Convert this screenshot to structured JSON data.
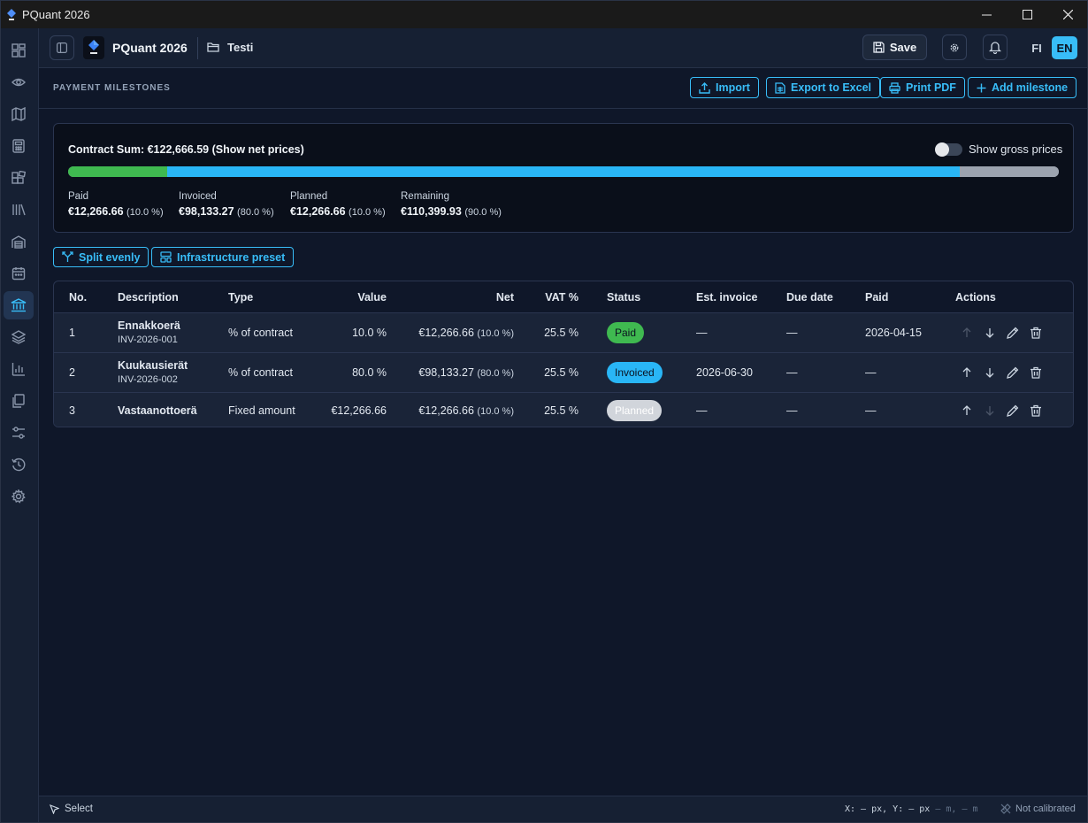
{
  "window": {
    "title": "PQuant 2026"
  },
  "header": {
    "app_name": "PQuant 2026",
    "project_name": "Testi",
    "save_label": "Save",
    "lang_fi": "FI",
    "lang_en": "EN"
  },
  "section": {
    "title": "PAYMENT MILESTONES",
    "buttons": {
      "import": "Import",
      "export_excel": "Export to Excel",
      "print_pdf": "Print PDF",
      "add_milestone": "Add milestone"
    }
  },
  "summary": {
    "contract_sum_label": "Contract Sum: €122,666.59 (Show net prices)",
    "toggle_label": "Show gross prices",
    "toggle_on": false,
    "progress": {
      "paid": 0.1,
      "invoiced": 0.8,
      "planned": 0.1
    },
    "colors": {
      "paid": "#3fb950",
      "invoiced": "#29b6f6",
      "planned": "#9ca3af"
    },
    "stats": {
      "paid": {
        "label": "Paid",
        "value": "€12,266.66",
        "pct": "(10.0 %)"
      },
      "invoiced": {
        "label": "Invoiced",
        "value": "€98,133.27",
        "pct": "(80.0 %)"
      },
      "planned": {
        "label": "Planned",
        "value": "€12,266.66",
        "pct": "(10.0 %)"
      },
      "remaining": {
        "label": "Remaining",
        "value": "€110,399.93",
        "pct": "(90.0 %)"
      }
    }
  },
  "presets": {
    "split_evenly": "Split evenly",
    "infrastructure": "Infrastructure preset"
  },
  "table": {
    "columns": {
      "no": "No.",
      "description": "Description",
      "type": "Type",
      "value": "Value",
      "net": "Net",
      "vat": "VAT %",
      "status": "Status",
      "est_invoice": "Est. invoice",
      "due_date": "Due date",
      "paid": "Paid",
      "actions": "Actions"
    },
    "rows": [
      {
        "no": "1",
        "description": "Ennakkoerä",
        "invoice": "INV-2026-001",
        "type": "% of contract",
        "value": "10.0 %",
        "net": "€12,266.66",
        "net_pct": "(10.0 %)",
        "vat": "25.5 %",
        "status": "Paid",
        "est_invoice": "—",
        "due_date": "—",
        "paid": "2026-04-15"
      },
      {
        "no": "2",
        "description": "Kuukausierät",
        "invoice": "INV-2026-002",
        "type": "% of contract",
        "value": "80.0 %",
        "net": "€98,133.27",
        "net_pct": "(80.0 %)",
        "vat": "25.5 %",
        "status": "Invoiced",
        "est_invoice": "2026-06-30",
        "due_date": "—",
        "paid": "—"
      },
      {
        "no": "3",
        "description": "Vastaanottoerä",
        "invoice": "",
        "type": "Fixed amount",
        "value": "€12,266.66",
        "net": "€12,266.66",
        "net_pct": "(10.0 %)",
        "vat": "25.5 %",
        "status": "Planned",
        "est_invoice": "—",
        "due_date": "—",
        "paid": "—"
      }
    ],
    "status_colors": {
      "Paid": "#3fb950",
      "Invoiced": "#29b6f6",
      "Planned": "#d1d5db"
    }
  },
  "statusbar": {
    "tool": "Select",
    "coords_x": "X: — px, Y: — px",
    "coords_m": " — m, — m",
    "calibration": "Not calibrated"
  }
}
